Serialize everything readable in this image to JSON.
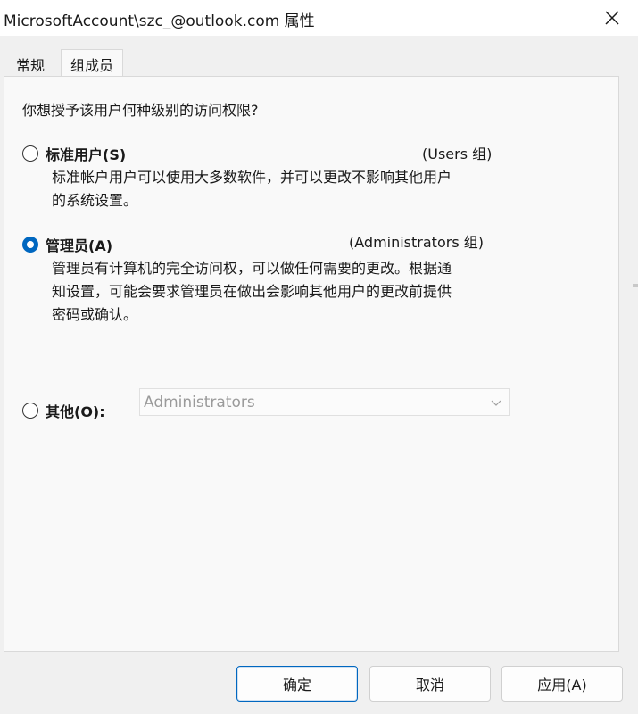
{
  "window": {
    "title": "MicrosoftAccount\\szc_@outlook.com 属性",
    "close_icon": "close-icon"
  },
  "tabs": [
    {
      "label": "常规",
      "selected": false
    },
    {
      "label": "组成员",
      "selected": true
    }
  ],
  "panel": {
    "question": "你想授予该用户何种级别的访问权限?",
    "options": [
      {
        "label": "标准用户(S)",
        "group": "(Users 组)",
        "description_lines": [
          "标准帐户用户可以使用大多数软件，并可以更改不影响其他用户",
          "的系统设置。"
        ],
        "checked": false
      },
      {
        "label": "管理员(A)",
        "group": "(Administrators 组)",
        "description_lines": [
          "管理员有计算机的完全访问权，可以做任何需要的更改。根据通",
          "知设置，可能会要求管理员在做出会影响其他用户的更改前提供",
          "密码或确认。"
        ],
        "checked": true
      },
      {
        "label": "其他(O):",
        "checked": false,
        "dropdown_value": "Administrators",
        "dropdown_enabled": false
      }
    ]
  },
  "buttons": {
    "ok": "确定",
    "cancel": "取消",
    "apply": "应用(A)"
  },
  "colors": {
    "accent": "#0067c0"
  }
}
